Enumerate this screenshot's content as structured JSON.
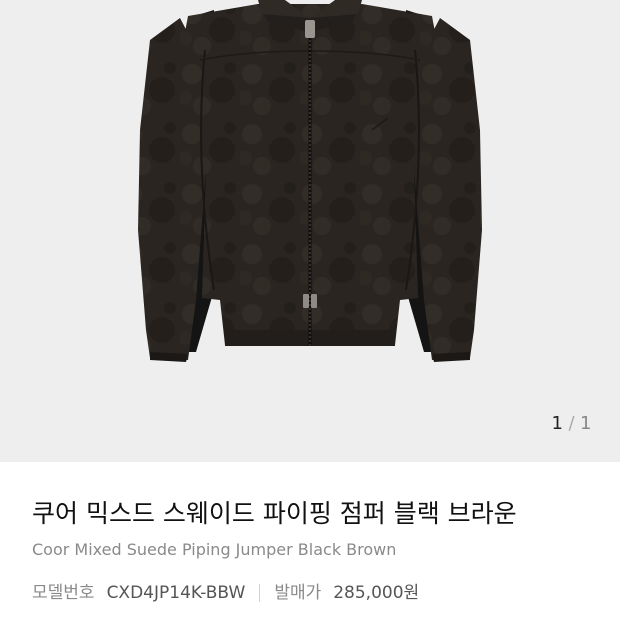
{
  "gallery": {
    "image_alt": "Coor Mixed Suede Piping Jumper Black Brown",
    "pager": {
      "current": "1",
      "separator": "/",
      "total": "1"
    }
  },
  "product": {
    "name_ko": "쿠어 믹스드 스웨이드 파이핑 점퍼 블랙 브라운",
    "name_en": "Coor Mixed Suede Piping Jumper Black Brown",
    "model_label": "모델번호",
    "model_number": "CXD4JP14K-BBW",
    "release_price_label": "발매가",
    "release_price": "285,000원"
  },
  "colors": {
    "background": "#eeeeee",
    "suede": "#2b2622",
    "side_panel": "#141414"
  }
}
